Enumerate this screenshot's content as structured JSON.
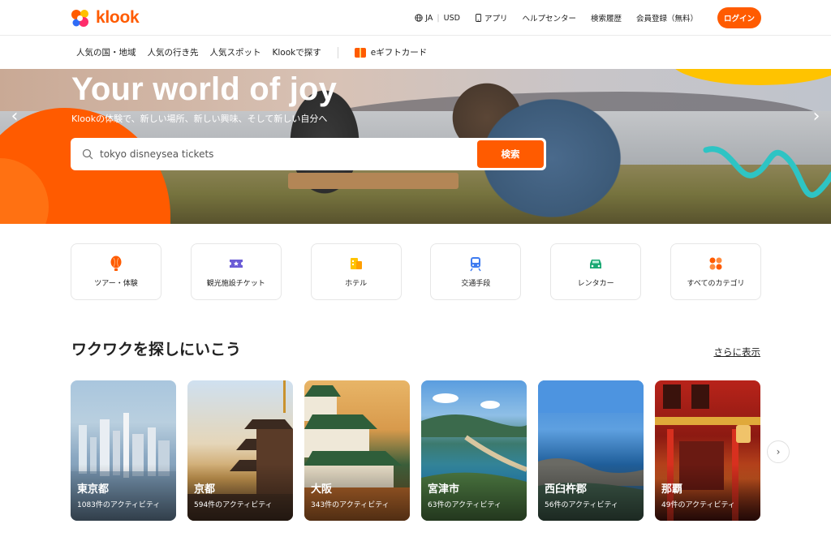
{
  "header": {
    "logo_text": "klook",
    "language": "JA",
    "currency": "USD",
    "app": "アプリ",
    "help": "ヘルプセンター",
    "history": "検索履歴",
    "signup": "会員登録（無料）",
    "login": "ログイン"
  },
  "subnav": {
    "items": [
      "人気の国・地域",
      "人気の行き先",
      "人気スポット",
      "Klookで探す"
    ],
    "gift": "eギフトカード"
  },
  "hero": {
    "title": "Your world of joy",
    "subtitle": "Klookの体験で、新しい場所、新しい興味、そして新しい自分へ",
    "search_placeholder": "tokyo disneysea tickets",
    "search_button": "検索"
  },
  "categories": [
    {
      "label": "ツアー・体験",
      "icon": "balloon-icon",
      "color": "#ff5b00"
    },
    {
      "label": "観光施設チケット",
      "icon": "ticket-icon",
      "color": "#6b5cd6"
    },
    {
      "label": "ホテル",
      "icon": "hotel-icon",
      "color": "#ffb300"
    },
    {
      "label": "交通手段",
      "icon": "train-icon",
      "color": "#3f7cf0"
    },
    {
      "label": "レンタカー",
      "icon": "car-icon",
      "color": "#1aa974"
    },
    {
      "label": "すべてのカテゴリ",
      "icon": "grid-icon",
      "color": "#ff5b00"
    }
  ],
  "section": {
    "title": "ワクワクを探しにいこう",
    "more": "さらに表示"
  },
  "destinations": [
    {
      "name": "東京都",
      "count": "1083件のアクティビティ"
    },
    {
      "name": "京都",
      "count": "594件のアクティビティ"
    },
    {
      "name": "大阪",
      "count": "343件のアクティビティ"
    },
    {
      "name": "宮津市",
      "count": "63件のアクティビティ"
    },
    {
      "name": "西臼杵郡",
      "count": "56件のアクティビティ"
    },
    {
      "name": "那覇",
      "count": "49件のアクティビティ"
    }
  ],
  "colors": {
    "accent": "#ff5b00"
  }
}
